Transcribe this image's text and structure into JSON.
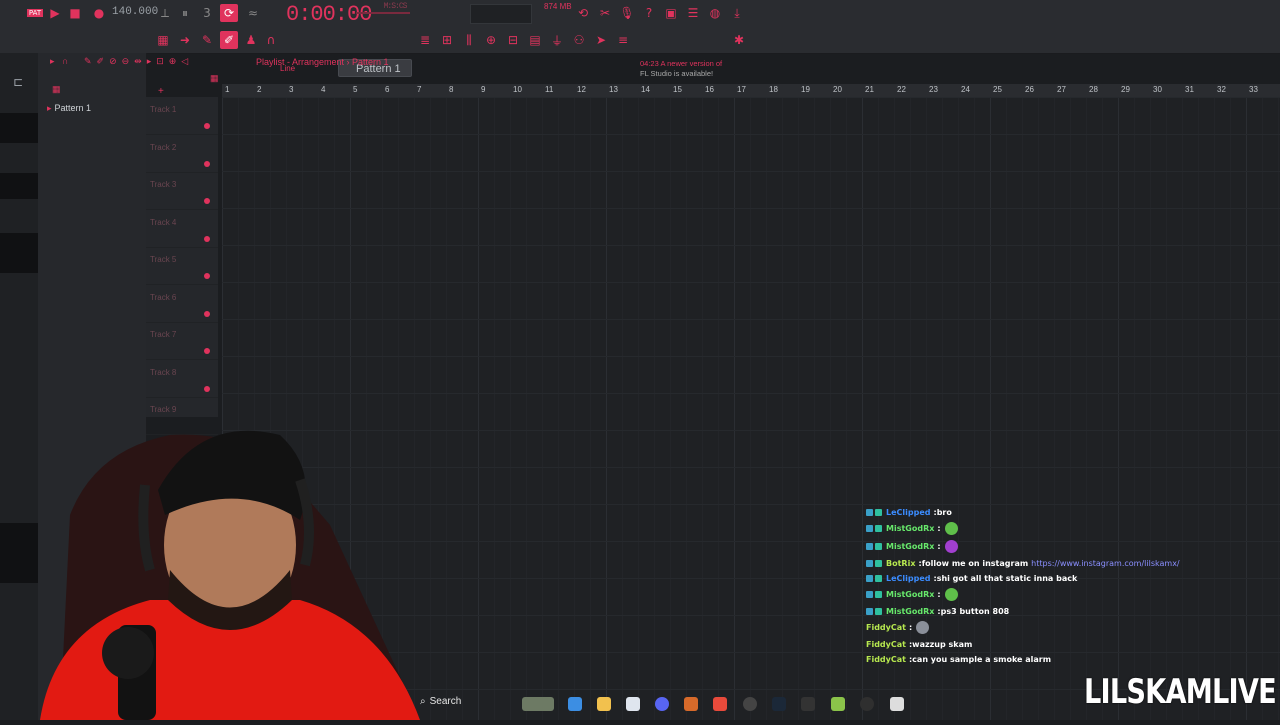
{
  "toolbar": {
    "tempo": "140.000",
    "time": "0:00:00",
    "time_unit": "M:S:CS",
    "memory": "874 MB",
    "pattern_selector": "Pattern 1",
    "snap_label": "Line",
    "news_line1": "04:23  A newer version of",
    "news_line2": "FL Studio is available!"
  },
  "playlist": {
    "breadcrumb": "Playlist - Arrangement › Pattern 1",
    "pattern_item": "Pattern 1",
    "tracks": [
      "Track 1",
      "Track 2",
      "Track 3",
      "Track 4",
      "Track 5",
      "Track 6",
      "Track 7",
      "Track 8",
      "Track 9"
    ],
    "bar_numbers": [
      "1",
      "2",
      "3",
      "4",
      "5",
      "6",
      "7",
      "8",
      "9",
      "10",
      "11",
      "12",
      "13",
      "14",
      "15",
      "16",
      "17",
      "18",
      "19",
      "20",
      "21",
      "22",
      "23",
      "24",
      "25",
      "26",
      "27",
      "28",
      "29",
      "30",
      "31",
      "32",
      "33"
    ]
  },
  "chat": {
    "messages": [
      {
        "user": "LeClipped",
        "text": "bro",
        "color": "#3b8cff"
      },
      {
        "user": "MistGodRx",
        "text": "",
        "color": "#67e86b",
        "emote": "green-face"
      },
      {
        "user": "MistGodRx",
        "text": "",
        "color": "#67e86b",
        "emote": "purple-emote"
      },
      {
        "user": "BotRix",
        "text": "follow me on instagram",
        "color": "#b7e84f",
        "link": "https://www.instagram.com/lilskamx/"
      },
      {
        "user": "LeClipped",
        "text": "shi got all that static inna back",
        "color": "#3b8cff"
      },
      {
        "user": "MistGodRx",
        "text": "",
        "color": "#67e86b",
        "emote": "green-face"
      },
      {
        "user": "MistGodRx",
        "text": "ps3 button 808",
        "color": "#67e86b"
      },
      {
        "user": "FiddyCat",
        "text": "",
        "color": "#b7e84f",
        "emote": "cat-emote"
      },
      {
        "user": "FiddyCat",
        "text": "wazzup skam",
        "color": "#b7e84f"
      },
      {
        "user": "FiddyCat",
        "text": "can you sample a smoke alarm",
        "color": "#b7e84f"
      }
    ]
  },
  "taskbar": {
    "search_label": "Search"
  },
  "brand": "LILSKAMLIVE"
}
